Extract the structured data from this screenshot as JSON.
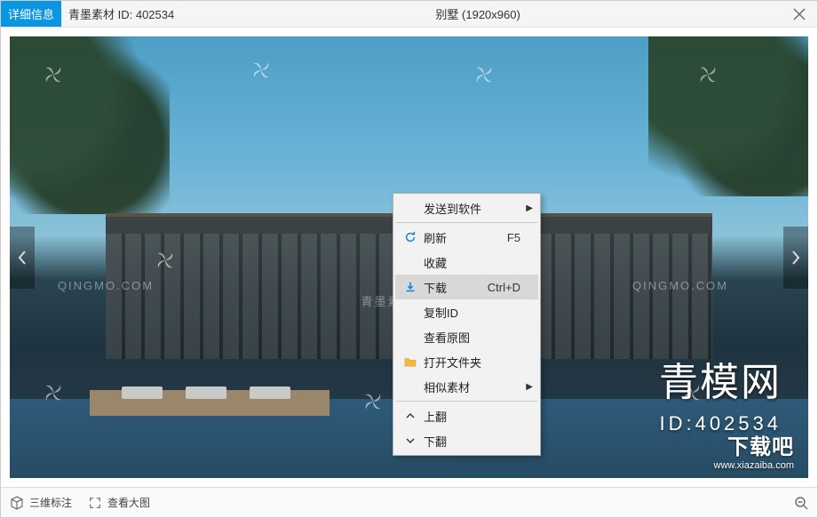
{
  "titlebar": {
    "badge": "详细信息",
    "source_label": "青墨素材 ID: 402534",
    "center_title": "别墅 (1920x960)"
  },
  "image": {
    "brand_logo_text": "青模网",
    "brand_id_text": "ID:402534",
    "watermark_qingmo": "QINGMO.COM",
    "watermark_center": "青墨素材",
    "download_brand": "下载吧",
    "download_url": "www.xiazaiba.com"
  },
  "context_menu": {
    "items": [
      {
        "label": "发送到软件",
        "icon": "",
        "submenu": true
      },
      {
        "sep": true
      },
      {
        "label": "刷新",
        "icon": "refresh",
        "shortcut": "F5"
      },
      {
        "label": "收藏",
        "icon": ""
      },
      {
        "label": "下载",
        "icon": "download",
        "shortcut": "Ctrl+D",
        "hover": true
      },
      {
        "label": "复制ID",
        "icon": ""
      },
      {
        "label": "查看原图",
        "icon": ""
      },
      {
        "label": "打开文件夹",
        "icon": "folder"
      },
      {
        "label": "相似素材",
        "icon": "",
        "submenu": true
      },
      {
        "sep": true
      },
      {
        "label": "上翻",
        "icon": "up"
      },
      {
        "label": "下翻",
        "icon": "down"
      }
    ]
  },
  "bottombar": {
    "annotate_3d": "三维标注",
    "view_large": "查看大图"
  }
}
